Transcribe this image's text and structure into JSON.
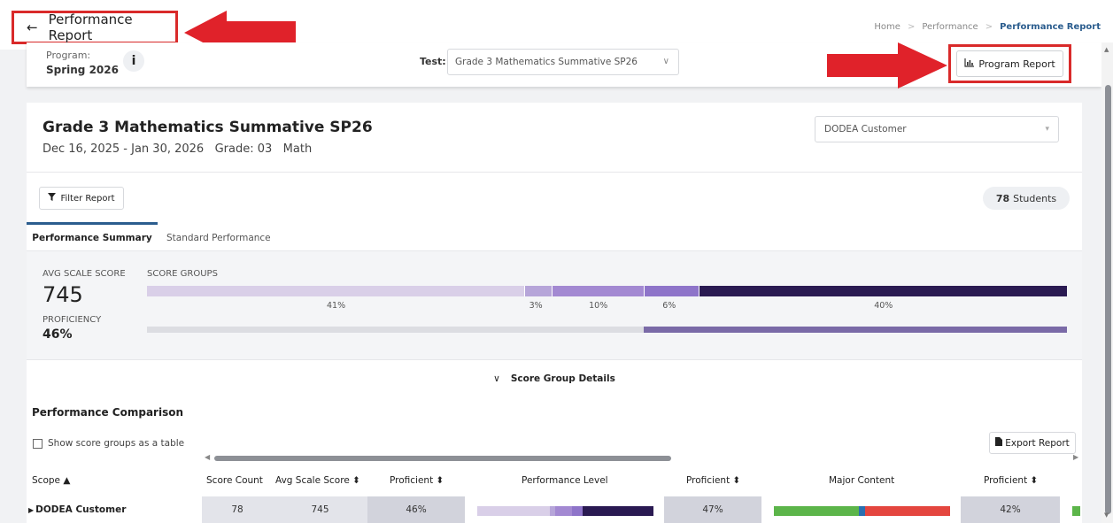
{
  "header": {
    "title": "Performance Report",
    "back_icon": "←",
    "breadcrumb": [
      "Home",
      "Performance",
      "Performance Report"
    ]
  },
  "program_bar": {
    "program_label": "Program:",
    "program_value": "Spring 2026",
    "info_icon": "i",
    "test_label": "Test:",
    "test_value": "Grade 3 Mathematics Summative SP26",
    "program_report_label": "Program Report"
  },
  "report": {
    "title": "Grade 3 Mathematics Summative SP26",
    "meta": "Dec 16, 2025 - Jan 30, 2026   Grade: 03   Math",
    "customer_select": "DODEA Customer",
    "filter_label": "Filter Report",
    "students_count": "78",
    "students_label": "Students"
  },
  "tabs": [
    {
      "label": "Performance Summary",
      "active": true
    },
    {
      "label": "Standard Performance",
      "active": false
    }
  ],
  "summary": {
    "avg_label": "AVG SCALE SCORE",
    "avg_value": "745",
    "prof_label": "PROFICIENCY",
    "prof_value": "46%",
    "score_groups_label": "SCORE GROUPS",
    "score_groups": [
      {
        "label": "41%",
        "value": 41,
        "color": "#d9cfe8"
      },
      {
        "label": "3%",
        "value": 3,
        "color": "#b6a5d9"
      },
      {
        "label": "10%",
        "value": 10,
        "color": "#a389d2"
      },
      {
        "label": "6%",
        "value": 6,
        "color": "#8e74c9"
      },
      {
        "label": "40%",
        "value": 40,
        "color": "#2a1a52"
      }
    ],
    "proficiency_fraction": 0.46,
    "score_group_details": "Score Group Details"
  },
  "comparison": {
    "title": "Performance Comparison",
    "checkbox_label": "Show score groups as a table",
    "export_label": "Export Report",
    "headers": [
      "Scope ▲",
      "Score Count",
      "Avg Scale Score ⬍",
      "Proficient ⬍",
      "Performance Level",
      "Proficient ⬍",
      "Major Content",
      "Proficient ⬍"
    ],
    "row": {
      "scope": "DODEA Customer",
      "score_count": "78",
      "avg_scale_score": "745",
      "proficient_1": "46%",
      "proficient_2": "47%",
      "proficient_3": "42%"
    },
    "major_content_segments": [
      {
        "value": 48,
        "color": "#5cb54a"
      },
      {
        "value": 4,
        "color": "#2a6fb0"
      },
      {
        "value": 48,
        "color": "#e4463f"
      }
    ]
  }
}
